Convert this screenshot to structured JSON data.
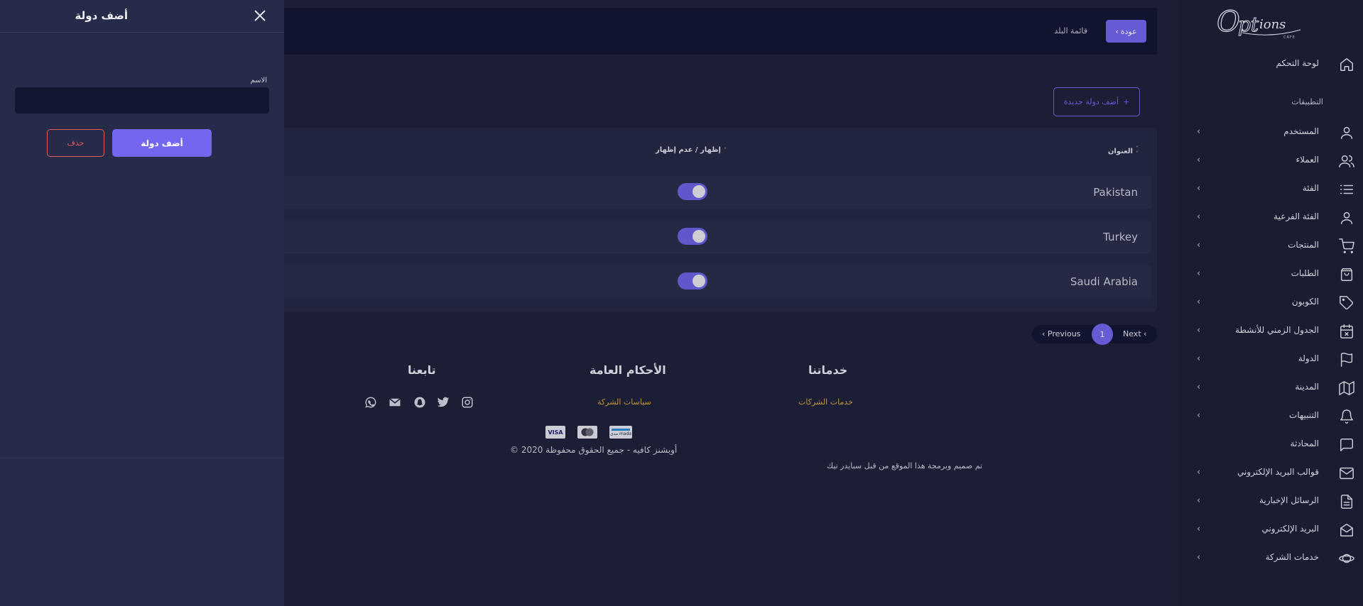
{
  "brand": {
    "logo_text": "Options",
    "logo_sub": "CAFE"
  },
  "colors": {
    "accent": "#7367f0",
    "danger": "#e05a5a",
    "gold": "#d6a93a",
    "sidebar_bg": "#1a1c31",
    "panel_bg": "#272b4a"
  },
  "sidebar": {
    "dashboard": "لوحة التحكم",
    "section_heading": "التطبيقات",
    "items": [
      {
        "label": "المستخدم",
        "icon": "user-icon"
      },
      {
        "label": "العملاء",
        "icon": "users-icon"
      },
      {
        "label": "الفئة",
        "icon": "list-icon"
      },
      {
        "label": "الفئة الفرعية",
        "icon": "user-icon"
      },
      {
        "label": "المنتجات",
        "icon": "cart-icon"
      },
      {
        "label": "الطلبات",
        "icon": "bag-icon"
      },
      {
        "label": "الكوبون",
        "icon": "tag-icon"
      },
      {
        "label": "الجدول الزمني للأنشطة",
        "icon": "calendar-x-icon"
      },
      {
        "label": "الدولة",
        "icon": "flag-icon"
      },
      {
        "label": "المدينة",
        "icon": "map-icon"
      },
      {
        "label": "التنبيهات",
        "icon": "bell-icon"
      },
      {
        "label": "المحادثة",
        "icon": "chat-icon"
      },
      {
        "label": "قوالب البريد الإلكتروني",
        "icon": "mail-icon"
      },
      {
        "label": "الرسائل الإخبارية",
        "icon": "file-text-icon"
      },
      {
        "label": "البريد الإلكتروني",
        "icon": "mail-open-icon"
      },
      {
        "label": "خدمات الشركة",
        "icon": "planet-icon"
      }
    ]
  },
  "topbar": {
    "back_label": "عودة",
    "breadcrumb": "قائمة البلد"
  },
  "add_new_label": "أضف دولة جديدة",
  "table": {
    "columns": {
      "title": "العنوان",
      "visibility": "إظهار / عدم إظهار"
    },
    "rows": [
      {
        "name": "Pakistan",
        "visible": true
      },
      {
        "name": "Turkey",
        "visible": true
      },
      {
        "name": "Saudi Arabia",
        "visible": true
      }
    ]
  },
  "pagination": {
    "previous": "Previous",
    "page": "1",
    "next": "Next"
  },
  "footer": {
    "services_title": "خدماتنا",
    "services_link": "خدمات الشركات",
    "terms_title": "الأحكام العامة",
    "terms_link": "سياسات الشركة",
    "follow_title": "تابعنا",
    "social_icons": [
      "instagram-icon",
      "twitter-icon",
      "snapchat-icon",
      "email-icon",
      "whatsapp-icon"
    ],
    "payment": {
      "visa": "VISA",
      "mada": "مدى mada"
    },
    "copyright": "© 2020 أوبشنز كافيه - جميع الحقوق محفوظة",
    "credit": "تم صميم وبرمجة هذا الموقع من قبل سبايدر تيك"
  },
  "panel": {
    "title": "أضف دولة",
    "field_label": "الاسم",
    "field_value": "",
    "field_placeholder": "",
    "submit_label": "أضف دولة",
    "delete_label": "حذف"
  }
}
